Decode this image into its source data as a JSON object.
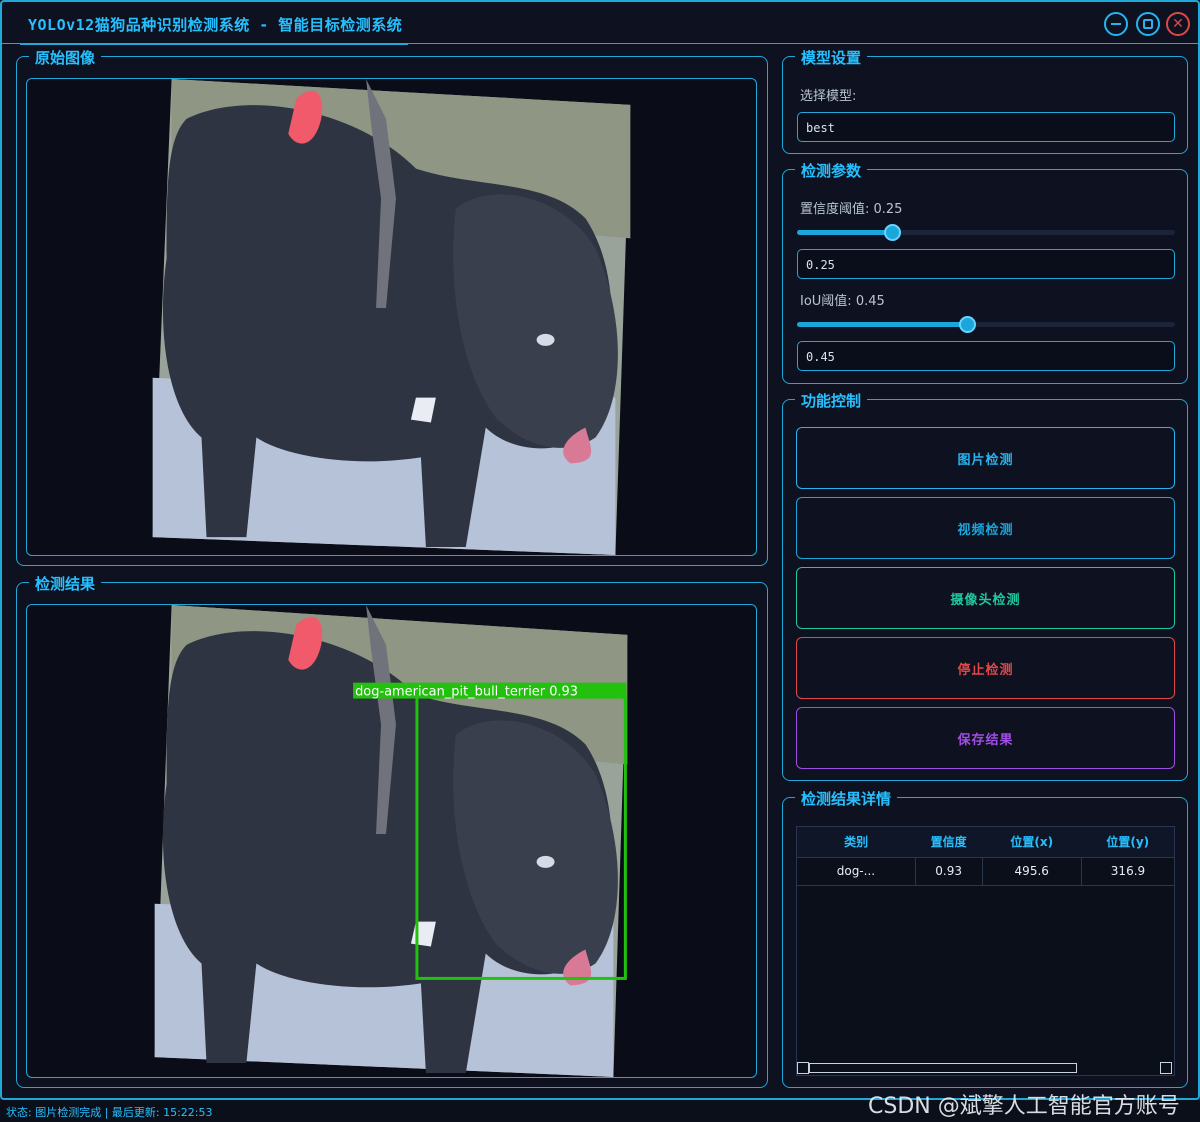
{
  "window": {
    "title": "YOLOv12猫狗品种识别检测系统 - 智能目标检测系统",
    "min_icon": "minimize-icon",
    "max_icon": "maximize-icon",
    "close_icon": "close-icon",
    "accent": "#1fa8d8"
  },
  "panels": {
    "original_title": "原始图像",
    "result_title": "检测结果"
  },
  "detection_overlay": {
    "label": "dog-american_pit_bull_terrier 0.93",
    "color": "#22c10e"
  },
  "model_settings": {
    "title": "模型设置",
    "select_label": "选择模型:",
    "selected_model": "best"
  },
  "params": {
    "title": "检测参数",
    "conf_label": "置信度阈值: 0.25",
    "conf_value": "0.25",
    "conf_fraction": 0.25,
    "iou_label": "IoU阈值: 0.45",
    "iou_value": "0.45",
    "iou_fraction": 0.45
  },
  "controls": {
    "title": "功能控制",
    "buttons": [
      {
        "label": "图片检测",
        "color": "#27b4f0"
      },
      {
        "label": "视频检测",
        "color": "#1aa6da"
      },
      {
        "label": "摄像头检测",
        "color": "#1fc8a0"
      },
      {
        "label": "停止检测",
        "color": "#e04848"
      },
      {
        "label": "保存结果",
        "color": "#a24ce6"
      }
    ]
  },
  "results": {
    "title": "检测结果详情",
    "columns": [
      "类别",
      "置信度",
      "位置(x)",
      "位置(y)"
    ],
    "rows": [
      [
        "dog-...",
        "0.93",
        "495.6",
        "316.9"
      ]
    ]
  },
  "status_bar": "状态: 图片检测完成 | 最后更新: 15:22:53",
  "watermark": "CSDN @斌擎人工智能官方账号"
}
